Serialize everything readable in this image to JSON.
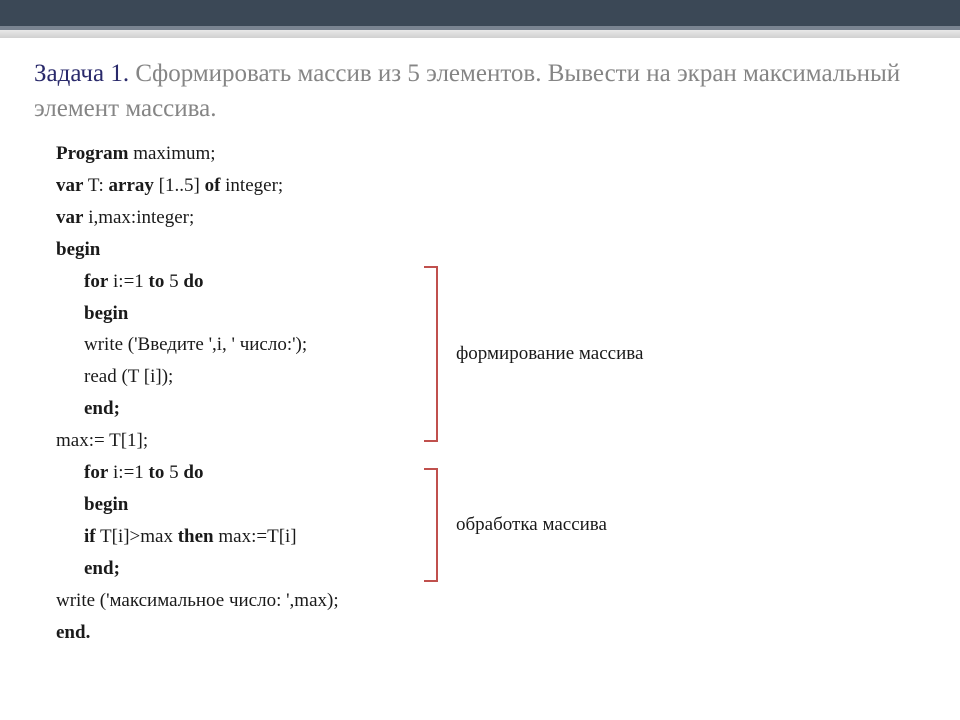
{
  "heading": {
    "label": "Задача 1.",
    "text": " Сформировать массив из 5 элементов. Вывести на экран максимальный элемент массива."
  },
  "code": {
    "l1_kw": "Program",
    "l1_rest": " maximum;",
    "l2_kw1": "var",
    "l2_mid": " T: ",
    "l2_kw2": "array",
    "l2_mid2": " [1..5] ",
    "l2_kw3": "of",
    "l2_rest": " integer;",
    "l3_kw": "var",
    "l3_rest": " i,max:integer;",
    "l4_kw": "begin",
    "l5_kw1": "for",
    "l5_mid": " i:=1 ",
    "l5_kw2": "to",
    "l5_mid2": " 5 ",
    "l5_kw3": "do",
    "l6_kw": "begin",
    "l7": "write ('Введите ',i, ' число:');",
    "l8": "read (T [i]);",
    "l9_kw": "end;",
    "l10": "max:= T[1];",
    "l11_kw1": "for",
    "l11_mid": " i:=1 ",
    "l11_kw2": "to",
    "l11_mid2": " 5 ",
    "l11_kw3": "do",
    "l12_kw": "begin",
    "l13_kw1": "if",
    "l13_mid": " T[i]>max ",
    "l13_kw2": "then",
    "l13_rest": " max:=T[i]",
    "l14_kw": "end;",
    "l15": "write ('максимальное число: ',max);",
    "l16_kw": "end."
  },
  "annotations": {
    "a1": "формирование массива",
    "a2": "обработка массива"
  }
}
